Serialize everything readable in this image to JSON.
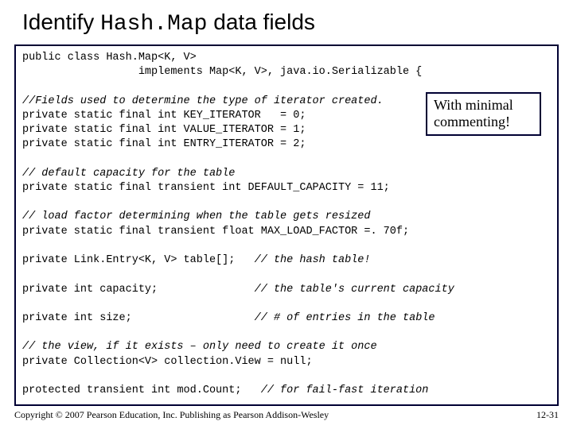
{
  "title": {
    "pre": "Identify ",
    "mono": "Hash.Map",
    "post": " data fields"
  },
  "code": {
    "l01": "public class Hash.Map<K, V>",
    "l02": "                  implements Map<K, V>, java.io.Serializable {",
    "l03": "",
    "l04": "//Fields used to determine the type of iterator created.",
    "l05": "private static final int KEY_ITERATOR   = 0;",
    "l06": "private static final int VALUE_ITERATOR = 1;",
    "l07": "private static final int ENTRY_ITERATOR = 2;",
    "l08": "",
    "l09": "// default capacity for the table",
    "l10": "private static final transient int DEFAULT_CAPACITY = 11;",
    "l11": "",
    "l12": "// load factor determining when the table gets resized",
    "l13": "private static final transient float MAX_LOAD_FACTOR =. 70f;",
    "l14": "",
    "l15a": "private Link.Entry<K, V> table[];   ",
    "l15b": "// the hash table!",
    "l16": "",
    "l17a": "private int capacity;               ",
    "l17b": "// the table's current capacity",
    "l18": "",
    "l19a": "private int size;                   ",
    "l19b": "// # of entries in the table",
    "l20": "",
    "l21": "// the view, if it exists – only need to create it once",
    "l22": "private Collection<V> collection.View = null;",
    "l23": "",
    "l24a": "protected transient int mod.Count;   ",
    "l24b": "// for fail-fast iteration"
  },
  "callout": "With minimal commenting!",
  "footer": {
    "left": "Copyright © 2007 Pearson Education, Inc. Publishing as Pearson Addison-Wesley",
    "right": "12-31"
  }
}
